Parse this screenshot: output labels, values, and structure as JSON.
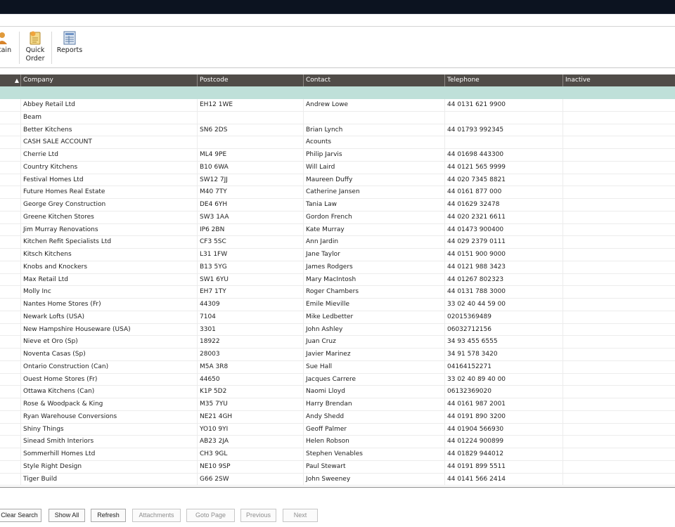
{
  "toolbar": {
    "maintain_label": "tain",
    "quick_order_line1": "Quick",
    "quick_order_line2": "Order",
    "reports_label": "Reports"
  },
  "grid": {
    "columns": [
      "Company",
      "Postcode",
      "Contact",
      "Telephone",
      "Inactive"
    ],
    "sort_indicator": "▲",
    "rows": [
      [
        "Abbey Retail Ltd",
        "EH12 1WE",
        "Andrew Lowe",
        "44 0131 621 9900",
        ""
      ],
      [
        "Beam",
        "",
        "",
        "",
        ""
      ],
      [
        "Better Kitchens",
        "SN6 2DS",
        "Brian Lynch",
        "44 01793 992345",
        ""
      ],
      [
        "CASH SALE ACCOUNT",
        "",
        "Acounts",
        "",
        ""
      ],
      [
        "Cherrie Ltd",
        "ML4 9PE",
        "Philip Jarvis",
        "44 01698 443300",
        ""
      ],
      [
        "Country Kitchens",
        "B10 6WA",
        "Will Laird",
        "44 0121 565 9999",
        ""
      ],
      [
        "Festival Homes Ltd",
        "SW12 7JJ",
        "Maureen Duffy",
        "44 020 7345 8821",
        ""
      ],
      [
        "Future Homes Real Estate",
        "M40 7TY",
        "Catherine Jansen",
        "44 0161 877 000",
        ""
      ],
      [
        "George Grey Construction",
        "DE4 6YH",
        "Tania Law",
        "44 01629 32478",
        ""
      ],
      [
        "Greene Kitchen Stores",
        "SW3 1AA",
        "Gordon French",
        "44 020 2321 6611",
        ""
      ],
      [
        "Jim Murray Renovations",
        "IP6 2BN",
        "Kate Murray",
        "44 01473 900400",
        ""
      ],
      [
        "Kitchen Refit Specialists Ltd",
        "CF3 5SC",
        "Ann Jardin",
        "44 029 2379 0111",
        ""
      ],
      [
        "Kitsch Kitchens",
        "L31 1FW",
        "Jane Taylor",
        "44 0151 900 9000",
        ""
      ],
      [
        "Knobs and Knockers",
        "B13 5YG",
        "James Rodgers",
        "44 0121 988 3423",
        ""
      ],
      [
        "Max Retail Ltd",
        "SW1 6YU",
        "Mary MacIntosh",
        "44 01267 802323",
        ""
      ],
      [
        "Molly Inc",
        "EH7 1TY",
        "Roger Chambers",
        "44 0131 788 3000",
        ""
      ],
      [
        "Nantes Home Stores (Fr)",
        "44309",
        "Emile Mieville",
        "33 02 40 44 59 00",
        ""
      ],
      [
        "Newark Lofts (USA)",
        "7104",
        "Mike Ledbetter",
        "02015369489",
        ""
      ],
      [
        "New Hampshire Houseware (USA)",
        "3301",
        "John Ashley",
        "06032712156",
        ""
      ],
      [
        "Nieve et Oro (Sp)",
        "18922",
        "Juan Cruz",
        "34 93 455 6555",
        ""
      ],
      [
        "Noventa Casas (Sp)",
        "28003",
        "Javier Marinez",
        "34 91 578 3420",
        ""
      ],
      [
        "Ontario Construction (Can)",
        "M5A 3R8",
        "Sue Hall",
        "04164152271",
        ""
      ],
      [
        "Ouest Home Stores (Fr)",
        "44650",
        "Jacques Carrere",
        "33 02 40 89 40 00",
        ""
      ],
      [
        "Ottawa Kitchens (Can)",
        "K1P 5D2",
        "Naomi Lloyd",
        "06132369020",
        ""
      ],
      [
        "Rose & Woodpack & King",
        "M35 7YU",
        "Harry Brendan",
        "44 0161 987 2001",
        ""
      ],
      [
        "Ryan Warehouse Conversions",
        "NE21 4GH",
        "Andy Shedd",
        "44 0191 890 3200",
        ""
      ],
      [
        "Shiny Things",
        "YO10 9YI",
        "Geoff Palmer",
        "44 01904 566930",
        ""
      ],
      [
        "Sinead Smith Interiors",
        "AB23 2JA",
        "Helen Robson",
        "44 01224 900899",
        ""
      ],
      [
        "Sommerhill Homes Ltd",
        "CH3 9GL",
        "Stephen Venables",
        "44 01829 944012",
        ""
      ],
      [
        "Style Right Design",
        "NE10 9SP",
        "Paul Stewart",
        "44 0191 899 5511",
        ""
      ],
      [
        "Tiger Build",
        "G66 2SW",
        "John Sweeney",
        "44 0141 566 2414",
        ""
      ]
    ]
  },
  "bottom": {
    "clear_search": "Clear Search",
    "show_all": "Show All",
    "refresh": "Refresh",
    "attachments": "Attachments",
    "goto_page": "Goto Page",
    "previous": "Previous",
    "next": "Next"
  }
}
